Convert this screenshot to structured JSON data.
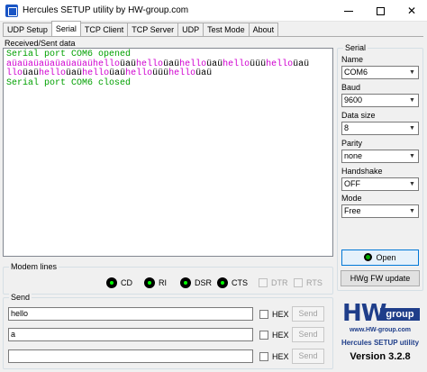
{
  "window": {
    "title": "Hercules SETUP utility by HW-group.com"
  },
  "tabs": [
    {
      "label": "UDP Setup",
      "active": false
    },
    {
      "label": "Serial",
      "active": true
    },
    {
      "label": "TCP Client",
      "active": false
    },
    {
      "label": "TCP Server",
      "active": false
    },
    {
      "label": "UDP",
      "active": false
    },
    {
      "label": "Test Mode",
      "active": false
    },
    {
      "label": "About",
      "active": false
    }
  ],
  "received": {
    "label": "Received/Sent data",
    "lines": [
      [
        {
          "text": "Serial port COM6 opened",
          "color": "green"
        }
      ],
      [
        {
          "text": "aüaüaüaüaüaüaüaü",
          "color": "magenta"
        },
        {
          "text": "hello",
          "color": "magenta"
        },
        {
          "text": "üaü",
          "color": "black"
        },
        {
          "text": "hello",
          "color": "magenta"
        },
        {
          "text": "üaü",
          "color": "black"
        },
        {
          "text": "hello",
          "color": "magenta"
        },
        {
          "text": "üaü",
          "color": "black"
        },
        {
          "text": "hello",
          "color": "magenta"
        },
        {
          "text": "üüü",
          "color": "black"
        },
        {
          "text": "hello",
          "color": "magenta"
        },
        {
          "text": "üaü",
          "color": "black"
        }
      ],
      [
        {
          "text": "llo",
          "color": "magenta"
        },
        {
          "text": "üaü",
          "color": "black"
        },
        {
          "text": "hello",
          "color": "magenta"
        },
        {
          "text": "üaü",
          "color": "black"
        },
        {
          "text": "hello",
          "color": "magenta"
        },
        {
          "text": "üaü",
          "color": "black"
        },
        {
          "text": "hello",
          "color": "magenta"
        },
        {
          "text": "üüü",
          "color": "black"
        },
        {
          "text": "hello",
          "color": "magenta"
        },
        {
          "text": "üaü",
          "color": "black"
        }
      ],
      [
        {
          "text": "Serial port COM6 closed",
          "color": "green"
        }
      ]
    ]
  },
  "modem": {
    "title": "Modem lines",
    "leds": [
      {
        "label": "CD"
      },
      {
        "label": "RI"
      },
      {
        "label": "DSR"
      },
      {
        "label": "CTS"
      }
    ],
    "outputs": [
      {
        "label": "DTR"
      },
      {
        "label": "RTS"
      }
    ]
  },
  "send": {
    "title": "Send",
    "rows": [
      {
        "value": "hello",
        "hex_label": "HEX",
        "button": "Send"
      },
      {
        "value": "a",
        "hex_label": "HEX",
        "button": "Send"
      },
      {
        "value": "",
        "hex_label": "HEX",
        "button": "Send"
      }
    ]
  },
  "serial": {
    "title": "Serial",
    "fields": [
      {
        "label": "Name",
        "value": "COM6"
      },
      {
        "label": "Baud",
        "value": "9600"
      },
      {
        "label": "Data size",
        "value": "8"
      },
      {
        "label": "Parity",
        "value": "none"
      },
      {
        "label": "Handshake",
        "value": "OFF"
      },
      {
        "label": "Mode",
        "value": "Free"
      }
    ],
    "open_label": "Open",
    "hwg_label": "HWg FW update"
  },
  "logo": {
    "hw": "HW",
    "group": "group",
    "url": "www.HW-group.com",
    "name": "Hercules SETUP utility",
    "version": "Version  3.2.8"
  },
  "colors": {
    "green": "#00a000",
    "magenta": "#d000d0",
    "black": "#000000",
    "brand": "#1f3e8a"
  }
}
